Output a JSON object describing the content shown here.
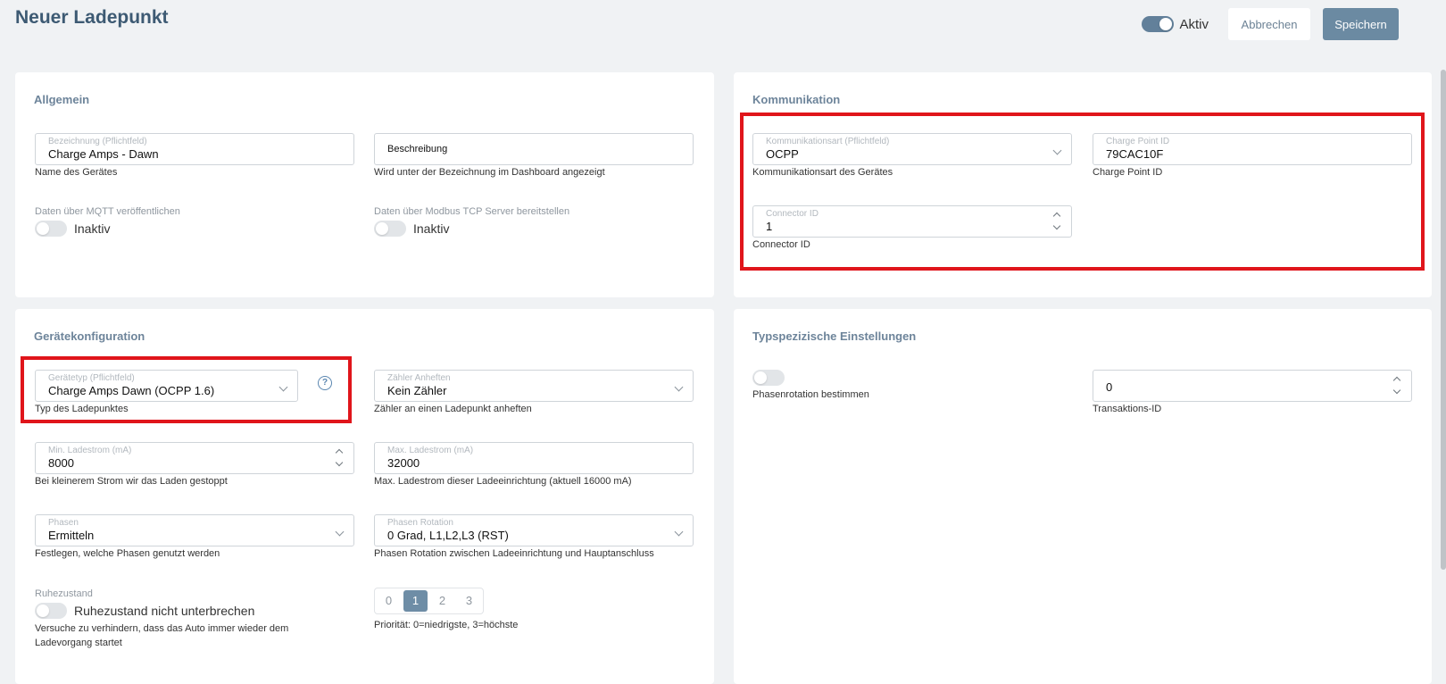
{
  "header": {
    "title": "Neuer Ladepunkt",
    "active_label": "Aktiv",
    "cancel_label": "Abbrechen",
    "save_label": "Speichern"
  },
  "allgemein": {
    "title": "Allgemein",
    "bezeichnung": {
      "label": "Bezeichnung (Pflichtfeld)",
      "value": "Charge Amps - Dawn",
      "hint": "Name des Gerätes"
    },
    "beschreibung": {
      "placeholder": "Beschreibung",
      "hint": "Wird unter der Bezeichnung im Dashboard angezeigt"
    },
    "mqtt": {
      "label": "Daten über MQTT veröffentlichen",
      "state": "Inaktiv"
    },
    "modbus": {
      "label": "Daten über Modbus TCP Server bereitstellen",
      "state": "Inaktiv"
    }
  },
  "kommunikation": {
    "title": "Kommunikation",
    "art": {
      "label": "Kommunikationsart (Pflichtfeld)",
      "value": "OCPP",
      "hint": "Kommunikationsart des Gerätes"
    },
    "charge_point_id": {
      "label": "Charge Point ID",
      "value": "79CAC10F",
      "hint": "Charge Point ID"
    },
    "connector_id": {
      "label": "Connector ID",
      "value": "1",
      "hint": "Connector ID"
    }
  },
  "geraetekonfiguration": {
    "title": "Gerätekonfiguration",
    "geraetetyp": {
      "label": "Gerätetyp (Pflichtfeld)",
      "value": "Charge Amps Dawn (OCPP 1.6)",
      "hint": "Typ des Ladepunktes"
    },
    "zaehler": {
      "label": "Zähler Anheften",
      "value": "Kein Zähler",
      "hint": "Zähler an einen Ladepunkt anheften"
    },
    "min_strom": {
      "label": "Min. Ladestrom (mA)",
      "value": "8000",
      "hint": "Bei kleinerem Strom wir das Laden gestoppt"
    },
    "max_strom": {
      "label": "Max. Ladestrom (mA)",
      "value": "32000",
      "hint": "Max. Ladestrom dieser Ladeeinrichtung (aktuell 16000 mA)"
    },
    "phasen": {
      "label": "Phasen",
      "value": "Ermitteln",
      "hint": "Festlegen, welche Phasen genutzt werden"
    },
    "phasen_rotation": {
      "label": "Phasen Rotation",
      "value": "0 Grad, L1,L2,L3 (RST)",
      "hint": "Phasen Rotation zwischen Ladeeinrichtung und Hauptanschluss"
    },
    "ruhezustand": {
      "label": "Ruhezustand",
      "toggle_text": "Ruhezustand nicht unterbrechen",
      "hint": "Versuche zu verhindern, dass das Auto immer wieder dem Ladevorgang startet"
    },
    "prioritaet": {
      "options": [
        "0",
        "1",
        "2",
        "3"
      ],
      "selected": "1",
      "hint": "Priorität: 0=niedrigste, 3=höchste"
    }
  },
  "typspezifisch": {
    "title": "Typspezizische Einstellungen",
    "phasenrotation": {
      "label": "Phasenrotation bestimmen"
    },
    "transaktions_id": {
      "value": "0",
      "hint": "Transaktions-ID"
    }
  },
  "colors": {
    "accent": "#6b8aa2",
    "highlight": "#e0151b",
    "title": "#3d5a73"
  }
}
